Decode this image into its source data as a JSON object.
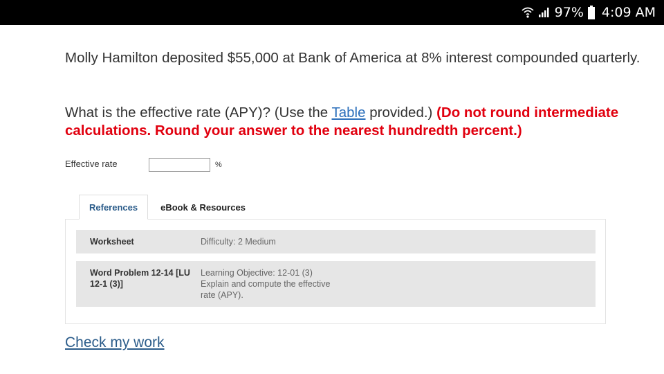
{
  "status_bar": {
    "battery": "97%",
    "time": "4:09 AM",
    "icons": [
      "wifi-icon",
      "signal-icon",
      "battery-icon"
    ]
  },
  "question": {
    "line1": "Molly Hamilton deposited $55,000 at Bank of America at 8% interest compounded quarterly.",
    "line2_pre": "What is the effective rate (APY)? (Use the ",
    "line2_link": "Table",
    "line2_post": " provided.) ",
    "line2_warning": "(Do not round intermediate calculations. Round your answer to the nearest hundredth percent.)"
  },
  "answer": {
    "label": "Effective rate",
    "value": "",
    "unit": "%"
  },
  "tabs": [
    {
      "label": "References",
      "active": true
    },
    {
      "label": "eBook & Resources",
      "active": false
    }
  ],
  "references": [
    {
      "key": "Worksheet",
      "value": "Difficulty: 2 Medium"
    },
    {
      "key": "Word Problem 12-14 [LU 12-1 (3)]",
      "value": "Learning Objective: 12-01 (3) Explain and compute the effective rate (APY)."
    }
  ],
  "check_link": "Check my work",
  "colors": {
    "warning": "#e1000f",
    "link": "#2a6ebb",
    "tab_active": "#2b5c8a"
  }
}
